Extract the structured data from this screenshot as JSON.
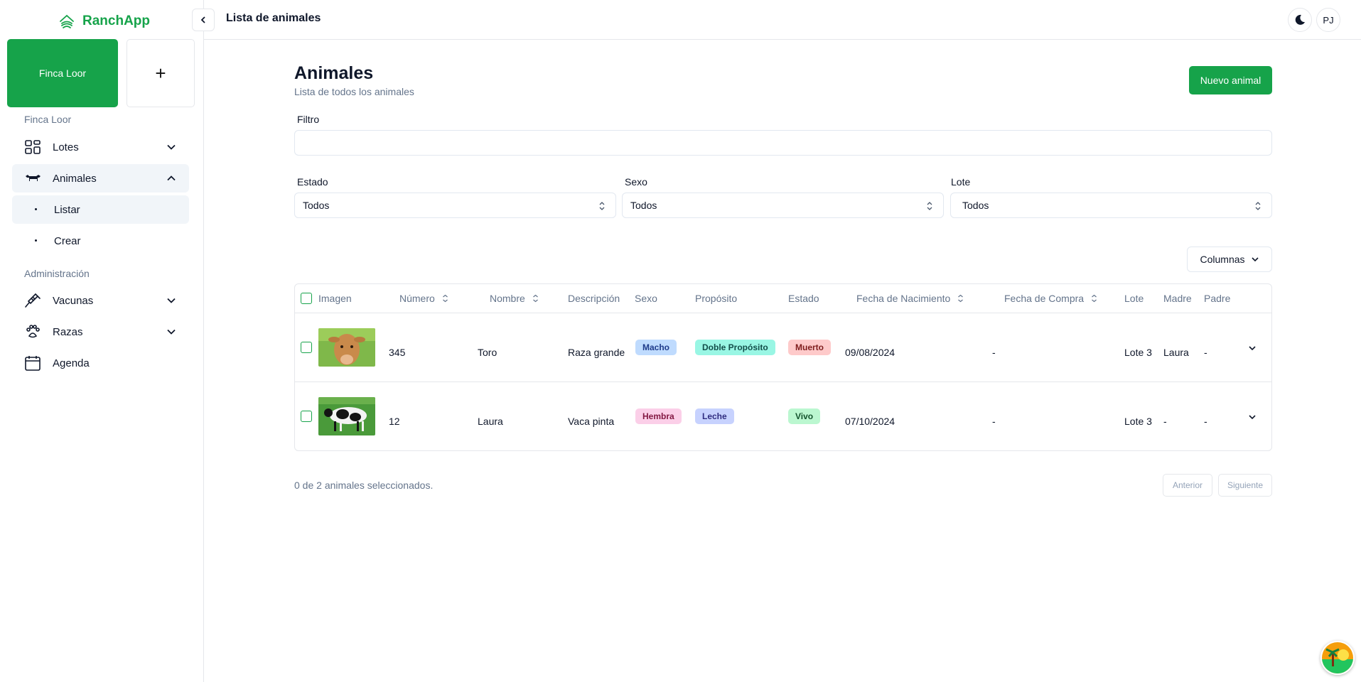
{
  "app": {
    "name": "RanchApp"
  },
  "sidebar": {
    "farm_card": "Finca Loor",
    "add_label": "+",
    "section_farm": "Finca Loor",
    "section_admin": "Administración",
    "items": [
      {
        "label": "Lotes",
        "icon": "grid-icon"
      },
      {
        "label": "Animales",
        "icon": "cow-icon"
      },
      {
        "label": "Vacunas",
        "icon": "syringe-icon"
      },
      {
        "label": "Razas",
        "icon": "paw-icon"
      },
      {
        "label": "Agenda",
        "icon": "calendar-icon"
      }
    ],
    "sub_items": [
      {
        "label": "Listar"
      },
      {
        "label": "Crear"
      }
    ]
  },
  "topbar": {
    "title": "Lista de animales",
    "avatar": "PJ"
  },
  "main": {
    "heading": "Animales",
    "subheading": "Lista de todos los animales",
    "new_button": "Nuevo animal",
    "filter_label": "Filtro",
    "filter_value": "",
    "selects": [
      {
        "label": "Estado",
        "value": "Todos"
      },
      {
        "label": "Sexo",
        "value": "Todos"
      },
      {
        "label": "Lote",
        "value": "Todos"
      }
    ],
    "columns_button": "Columnas"
  },
  "table": {
    "columns": [
      "Imagen",
      "Número",
      "Nombre",
      "Descripción",
      "Sexo",
      "Propósito",
      "Estado",
      "Fecha de Nacimiento",
      "Fecha de Compra",
      "Lote",
      "Madre",
      "Padre"
    ],
    "rows": [
      {
        "numero": "345",
        "nombre": "Toro",
        "descripcion": "Raza grande",
        "sexo": "Macho",
        "proposito": "Doble Propósito",
        "estado": "Muerto",
        "nacimiento": "09/08/2024",
        "compra": "-",
        "lote": "Lote 3",
        "madre": "Laura",
        "padre": "-"
      },
      {
        "numero": "12",
        "nombre": "Laura",
        "descripcion": "Vaca pinta",
        "sexo": "Hembra",
        "proposito": "Leche",
        "estado": "Vivo",
        "nacimiento": "07/10/2024",
        "compra": "-",
        "lote": "Lote 3",
        "madre": "-",
        "padre": "-"
      }
    ]
  },
  "footer": {
    "selection": "0 de 2 animales seleccionados.",
    "prev": "Anterior",
    "next": "Siguiente"
  },
  "colors": {
    "accent": "#16a34a",
    "badge_macho": "#bfdbfe",
    "badge_hembra": "#fbcfe8",
    "badge_doble": "#99f6e4",
    "badge_leche": "#c7d2fe",
    "badge_muerto": "#fecaca",
    "badge_vivo": "#bbf7d0"
  }
}
